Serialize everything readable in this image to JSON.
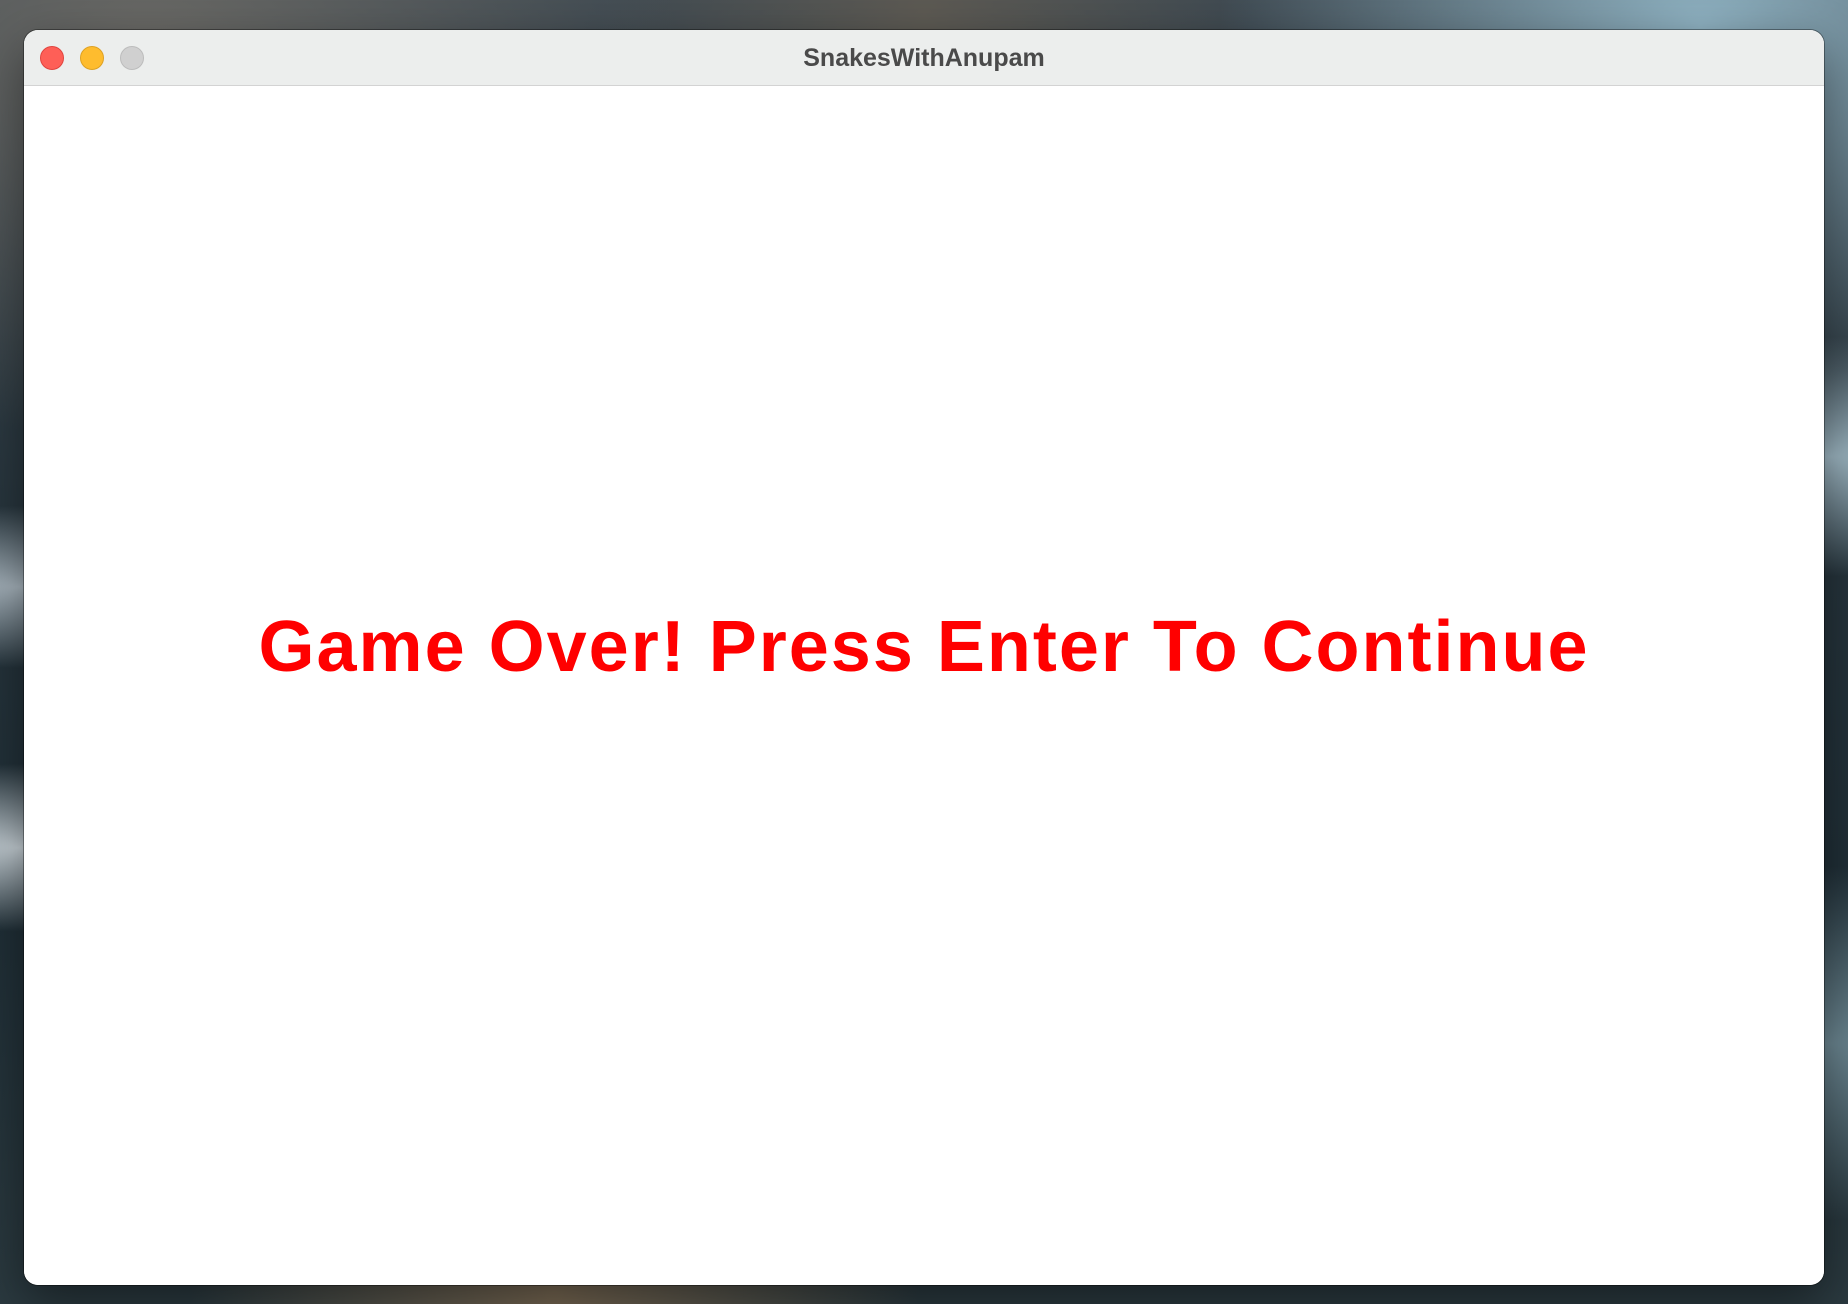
{
  "window": {
    "title": "SnakesWithAnupam"
  },
  "game": {
    "message": "Game Over! Press Enter To Continue",
    "message_color": "#ff0000"
  },
  "icons": {
    "close": "close-icon",
    "minimize": "minimize-icon",
    "zoom": "zoom-icon"
  }
}
